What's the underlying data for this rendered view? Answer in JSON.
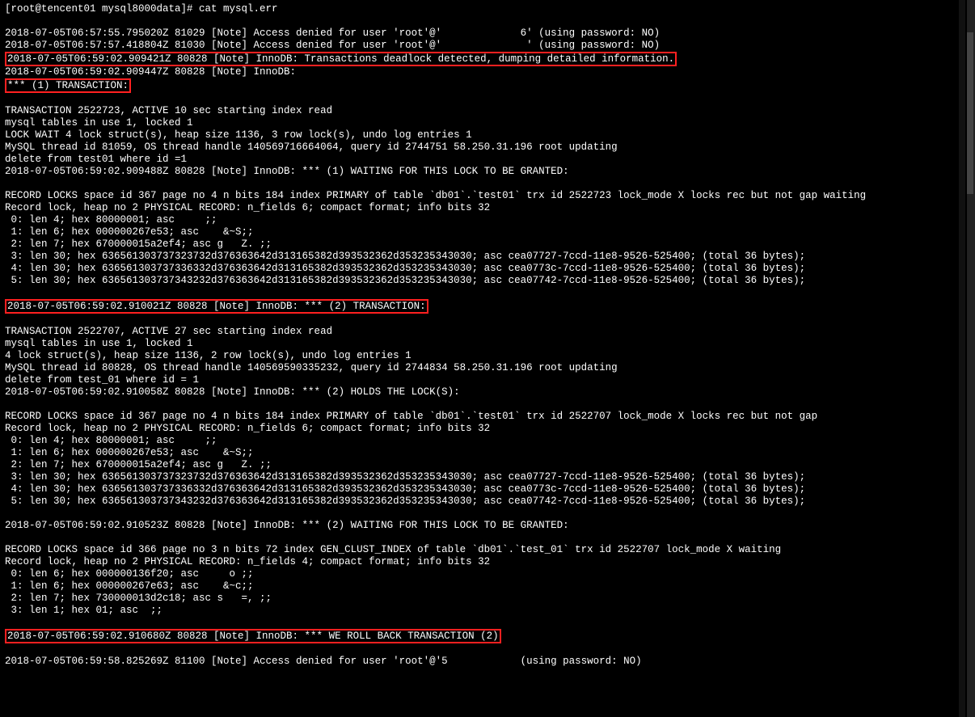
{
  "terminal": {
    "prompt": "[root@tencent01 mysql8000data]# cat mysql.err",
    "blank1": "",
    "l1": "2018-07-05T06:57:55.795020Z 81029 [Note] Access denied for user 'root'@'             6' (using password: NO)",
    "l2": "2018-07-05T06:57:57.418804Z 81030 [Note] Access denied for user 'root'@'              ' (using password: NO)",
    "hl1": "2018-07-05T06:59:02.909421Z 80828 [Note] InnoDB: Transactions deadlock detected, dumping detailed information.",
    "l3": "2018-07-05T06:59:02.909447Z 80828 [Note] InnoDB:",
    "hl2": "*** (1) TRANSACTION:",
    "blank2": "",
    "l4": "TRANSACTION 2522723, ACTIVE 10 sec starting index read",
    "l5": "mysql tables in use 1, locked 1",
    "l6": "LOCK WAIT 4 lock struct(s), heap size 1136, 3 row lock(s), undo log entries 1",
    "l7": "MySQL thread id 81059, OS thread handle 140569716664064, query id 2744751 58.250.31.196 root updating",
    "l8": "delete from test01 where id =1",
    "l9": "2018-07-05T06:59:02.909488Z 80828 [Note] InnoDB: *** (1) WAITING FOR THIS LOCK TO BE GRANTED:",
    "blank3": "",
    "l10": "RECORD LOCKS space id 367 page no 4 n bits 184 index PRIMARY of table `db01`.`test01` trx id 2522723 lock_mode X locks rec but not gap waiting",
    "l11": "Record lock, heap no 2 PHYSICAL RECORD: n_fields 6; compact format; info bits 32",
    "l12": " 0: len 4; hex 80000001; asc     ;;",
    "l13": " 1: len 6; hex 000000267e53; asc    &~S;;",
    "l14": " 2: len 7; hex 670000015a2ef4; asc g   Z. ;;",
    "l15": " 3: len 30; hex 636561303737323732d376363642d313165382d393532362d353235343030; asc cea07727-7ccd-11e8-9526-525400; (total 36 bytes);",
    "l16": " 4: len 30; hex 636561303737336332d376363642d313165382d393532362d353235343030; asc cea0773c-7ccd-11e8-9526-525400; (total 36 bytes);",
    "l17": " 5: len 30; hex 636561303737343232d376363642d313165382d393532362d353235343030; asc cea07742-7ccd-11e8-9526-525400; (total 36 bytes);",
    "blank4": "",
    "hl3": "2018-07-05T06:59:02.910021Z 80828 [Note] InnoDB: *** (2) TRANSACTION:",
    "blank5": "",
    "l18": "TRANSACTION 2522707, ACTIVE 27 sec starting index read",
    "l19": "mysql tables in use 1, locked 1",
    "l20": "4 lock struct(s), heap size 1136, 2 row lock(s), undo log entries 1",
    "l21": "MySQL thread id 80828, OS thread handle 140569590335232, query id 2744834 58.250.31.196 root updating",
    "l22": "delete from test_01 where id = 1",
    "l23": "2018-07-05T06:59:02.910058Z 80828 [Note] InnoDB: *** (2) HOLDS THE LOCK(S):",
    "blank6": "",
    "l24": "RECORD LOCKS space id 367 page no 4 n bits 184 index PRIMARY of table `db01`.`test01` trx id 2522707 lock_mode X locks rec but not gap",
    "l25": "Record lock, heap no 2 PHYSICAL RECORD: n_fields 6; compact format; info bits 32",
    "l26": " 0: len 4; hex 80000001; asc     ;;",
    "l27": " 1: len 6; hex 000000267e53; asc    &~S;;",
    "l28": " 2: len 7; hex 670000015a2ef4; asc g   Z. ;;",
    "l29": " 3: len 30; hex 636561303737323732d376363642d313165382d393532362d353235343030; asc cea07727-7ccd-11e8-9526-525400; (total 36 bytes);",
    "l30": " 4: len 30; hex 636561303737336332d376363642d313165382d393532362d353235343030; asc cea0773c-7ccd-11e8-9526-525400; (total 36 bytes);",
    "l31": " 5: len 30; hex 636561303737343232d376363642d313165382d393532362d353235343030; asc cea07742-7ccd-11e8-9526-525400; (total 36 bytes);",
    "blank7": "",
    "l32": "2018-07-05T06:59:02.910523Z 80828 [Note] InnoDB: *** (2) WAITING FOR THIS LOCK TO BE GRANTED:",
    "blank8": "",
    "l33": "RECORD LOCKS space id 366 page no 3 n bits 72 index GEN_CLUST_INDEX of table `db01`.`test_01` trx id 2522707 lock_mode X waiting",
    "l34": "Record lock, heap no 2 PHYSICAL RECORD: n_fields 4; compact format; info bits 32",
    "l35": " 0: len 6; hex 000000136f20; asc     o ;;",
    "l36": " 1: len 6; hex 000000267e63; asc    &~c;;",
    "l37": " 2: len 7; hex 730000013d2c18; asc s   =, ;;",
    "l38": " 3: len 1; hex 01; asc  ;;",
    "blank9": "",
    "hl4": "2018-07-05T06:59:02.910680Z 80828 [Note] InnoDB: *** WE ROLL BACK TRANSACTION (2)",
    "blank10": "",
    "l39": "2018-07-05T06:59:58.825269Z 81100 [Note] Access denied for user 'root'@'5            (using password: NO)"
  }
}
